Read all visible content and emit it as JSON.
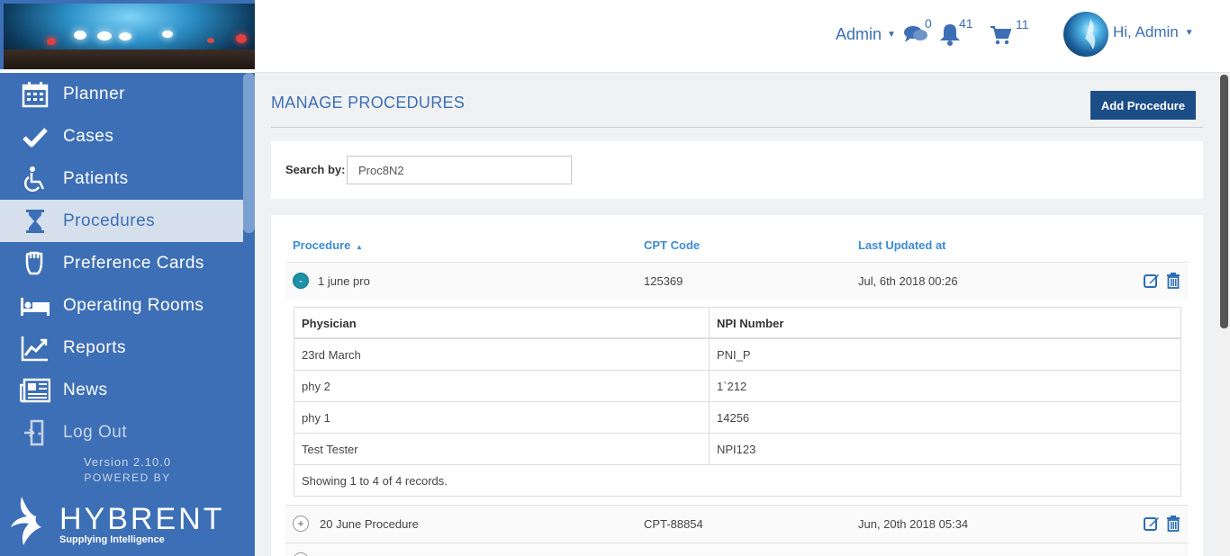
{
  "sidebar": {
    "items": [
      {
        "label": "Planner",
        "icon": "calendar-icon"
      },
      {
        "label": "Cases",
        "icon": "check-icon"
      },
      {
        "label": "Patients",
        "icon": "wheelchair-icon"
      },
      {
        "label": "Procedures",
        "icon": "hourglass-icon",
        "active": true
      },
      {
        "label": "Preference Cards",
        "icon": "hand-icon"
      },
      {
        "label": "Operating Rooms",
        "icon": "bed-icon"
      },
      {
        "label": "Reports",
        "icon": "line-chart-icon"
      },
      {
        "label": "News",
        "icon": "newspaper-icon"
      },
      {
        "label": "Log Out",
        "icon": "logout-door-icon"
      }
    ],
    "version": "Version 2.10.0",
    "powered_by": "POWERED BY",
    "brand": {
      "name": "HYBRENT",
      "tagline": "Supplying Intelligence"
    }
  },
  "header": {
    "admin_menu": "Admin",
    "messages_count": "0",
    "notifications_count": "41",
    "cart_count": "11",
    "greeting": "Hi, Admin"
  },
  "main": {
    "title": "MANAGE PROCEDURES",
    "add_button": "Add Procedure",
    "search": {
      "label": "Search by:",
      "value": "Proc8N2"
    },
    "columns": {
      "procedure": "Procedure",
      "cpt": "CPT Code",
      "updated": "Last Updated at"
    },
    "rows": [
      {
        "toggle": "-",
        "name": "1 june pro",
        "cpt": "125369",
        "updated": "Jul, 6th 2018 00:26"
      },
      {
        "toggle": "+",
        "name": "20 June Procedure",
        "cpt": "CPT-88854",
        "updated": "Jun, 20th 2018 05:34"
      }
    ],
    "sub_table": {
      "headers": {
        "physician": "Physician",
        "npi": "NPI Number"
      },
      "rows": [
        {
          "physician": "23rd March",
          "npi": "PNI_P"
        },
        {
          "physician": "phy 2",
          "npi": "1`212"
        },
        {
          "physician": "phy 1",
          "npi": "14256"
        },
        {
          "physician": "Test Tester",
          "npi": "NPI123"
        }
      ],
      "footer": "Showing 1 to 4 of 4 records."
    }
  },
  "colors": {
    "sidebar": "#3d6fb6",
    "accent": "#3d8bd4",
    "button": "#1b4e86",
    "toggle_open": "#1e90a8"
  }
}
